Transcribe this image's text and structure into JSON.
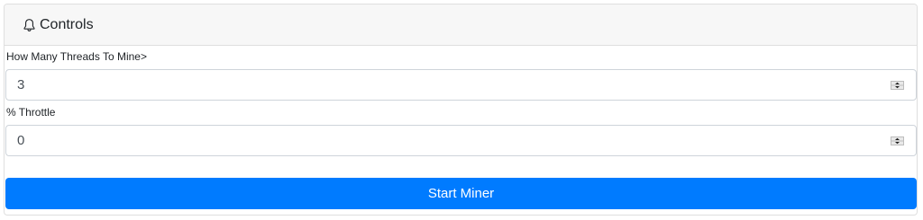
{
  "card": {
    "title": "Controls",
    "icon": "bell-icon"
  },
  "threads": {
    "label": "How Many Threads To Mine>",
    "value": "3"
  },
  "throttle": {
    "label": "% Throttle",
    "value": "0"
  },
  "actions": {
    "start_label": "Start Miner"
  },
  "colors": {
    "primary": "#007bff",
    "header_bg": "#f7f7f7",
    "border": "#dfdfdf"
  }
}
